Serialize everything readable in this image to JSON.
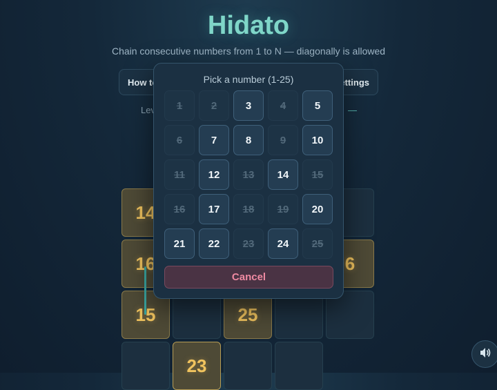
{
  "app": {
    "title": "Hidato",
    "subtitle": "Chain consecutive numbers from 1 to N — diagonally is allowed"
  },
  "toolbar": {
    "howto_label": "How to",
    "settings_label": "ettings"
  },
  "status": {
    "level_label": "Lev",
    "dash_label": "—"
  },
  "board": {
    "cells": [
      {
        "value": "14",
        "state": "given"
      },
      {
        "value": "16",
        "state": "given"
      },
      {
        "value": "6",
        "state": "given"
      },
      {
        "value": "15",
        "state": "given"
      },
      {
        "value": "25",
        "state": "given"
      },
      {
        "value": "",
        "state": "empty"
      },
      {
        "value": "23",
        "state": "given"
      },
      {
        "value": "",
        "state": "empty"
      },
      {
        "value": "",
        "state": "empty"
      },
      {
        "value": "",
        "state": "empty"
      },
      {
        "value": "",
        "state": "empty"
      },
      {
        "value": "",
        "state": "empty"
      },
      {
        "value": "",
        "state": "empty"
      }
    ]
  },
  "picker": {
    "title": "Pick a number (1-25)",
    "numbers": [
      {
        "n": "1",
        "available": false
      },
      {
        "n": "2",
        "available": false
      },
      {
        "n": "3",
        "available": true
      },
      {
        "n": "4",
        "available": false
      },
      {
        "n": "5",
        "available": true
      },
      {
        "n": "6",
        "available": false
      },
      {
        "n": "7",
        "available": true
      },
      {
        "n": "8",
        "available": true
      },
      {
        "n": "9",
        "available": false
      },
      {
        "n": "10",
        "available": true
      },
      {
        "n": "11",
        "available": false
      },
      {
        "n": "12",
        "available": true
      },
      {
        "n": "13",
        "available": false
      },
      {
        "n": "14",
        "available": true
      },
      {
        "n": "15",
        "available": false
      },
      {
        "n": "16",
        "available": false
      },
      {
        "n": "17",
        "available": true
      },
      {
        "n": "18",
        "available": false
      },
      {
        "n": "19",
        "available": false
      },
      {
        "n": "20",
        "available": true
      },
      {
        "n": "21",
        "available": true
      },
      {
        "n": "22",
        "available": true
      },
      {
        "n": "23",
        "available": false
      },
      {
        "n": "24",
        "available": true
      },
      {
        "n": "25",
        "available": false
      }
    ],
    "cancel_label": "Cancel"
  },
  "icons": {
    "sound": "speaker-icon"
  },
  "colors": {
    "accent": "#7fd6c8",
    "given_tile": "#f0c35e",
    "cancel": "#ef8aa2"
  }
}
